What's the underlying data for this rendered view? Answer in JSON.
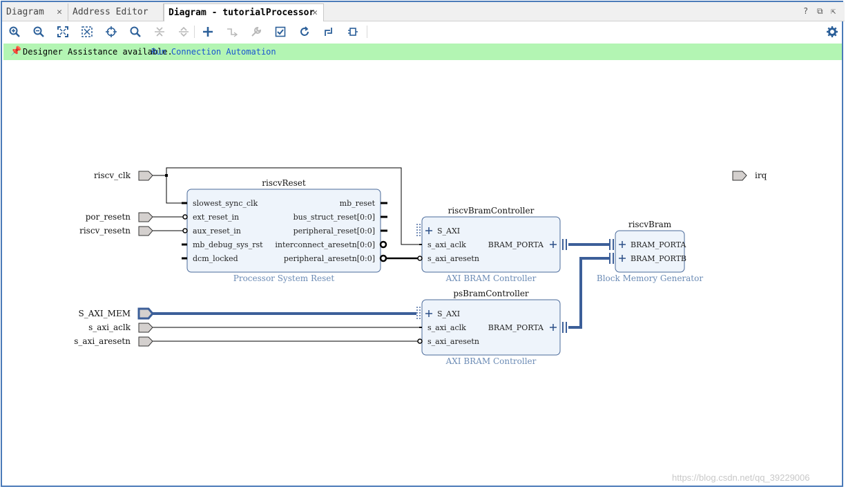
{
  "tabs": [
    {
      "label": "Diagram",
      "close": "✕"
    },
    {
      "label": "Address Editor",
      "close": ""
    },
    {
      "label": "Diagram - tutorialProcessor",
      "close": "✕"
    }
  ],
  "window_controls": {
    "help": "?",
    "restore": "⧉",
    "float": "⇱"
  },
  "toolbar": {
    "icons": [
      "zoom-in-icon",
      "zoom-out-icon",
      "zoom-fit-icon",
      "fit-selection-icon",
      "crosshair-icon",
      "search-icon",
      "collapse-icon",
      "expand-icon",
      "add-ip-icon",
      "make-connection-icon",
      "wrench-icon",
      "validate-icon",
      "refresh-icon",
      "regenerate-layout-icon",
      "optimize-routing-icon",
      "settings-icon"
    ]
  },
  "banner": {
    "text": "Designer Assistance available.",
    "link": "Run Connection Automation",
    "color": "#b3f5b3"
  },
  "diagram": {
    "external_ports": {
      "riscv_clk": "riscv_clk",
      "por_resetn": "por_resetn",
      "riscv_resetn": "riscv_resetn",
      "S_AXI_MEM": "S_AXI_MEM",
      "s_axi_aclk": "s_axi_aclk",
      "s_axi_aresetn": "s_axi_aresetn",
      "irq": "irq"
    },
    "blocks": {
      "riscvReset": {
        "name": "riscvReset",
        "type": "Processor System Reset",
        "inputs": [
          "slowest_sync_clk",
          "ext_reset_in",
          "aux_reset_in",
          "mb_debug_sys_rst",
          "dcm_locked"
        ],
        "outputs": [
          "mb_reset",
          "bus_struct_reset[0:0]",
          "peripheral_reset[0:0]",
          "interconnect_aresetn[0:0]",
          "peripheral_aresetn[0:0]"
        ]
      },
      "riscvBramController": {
        "name": "riscvBramController",
        "type": "AXI BRAM Controller",
        "inputs": [
          "S_AXI",
          "s_axi_aclk",
          "s_axi_aresetn"
        ],
        "outputs": [
          "BRAM_PORTA"
        ]
      },
      "psBramController": {
        "name": "psBramController",
        "type": "AXI BRAM Controller",
        "inputs": [
          "S_AXI",
          "s_axi_aclk",
          "s_axi_aresetn"
        ],
        "outputs": [
          "BRAM_PORTA"
        ]
      },
      "riscvBram": {
        "name": "riscvBram",
        "type": "Block Memory Generator",
        "inputs": [
          "BRAM_PORTA",
          "BRAM_PORTB"
        ]
      }
    },
    "colors": {
      "block_fill": "#eef4fb",
      "block_border": "#4a6a9a",
      "bus": "#3c5f99",
      "wire": "#000000",
      "type_label": "#6b8bb5"
    }
  },
  "watermark": "https://blog.csdn.net/qq_39229006"
}
